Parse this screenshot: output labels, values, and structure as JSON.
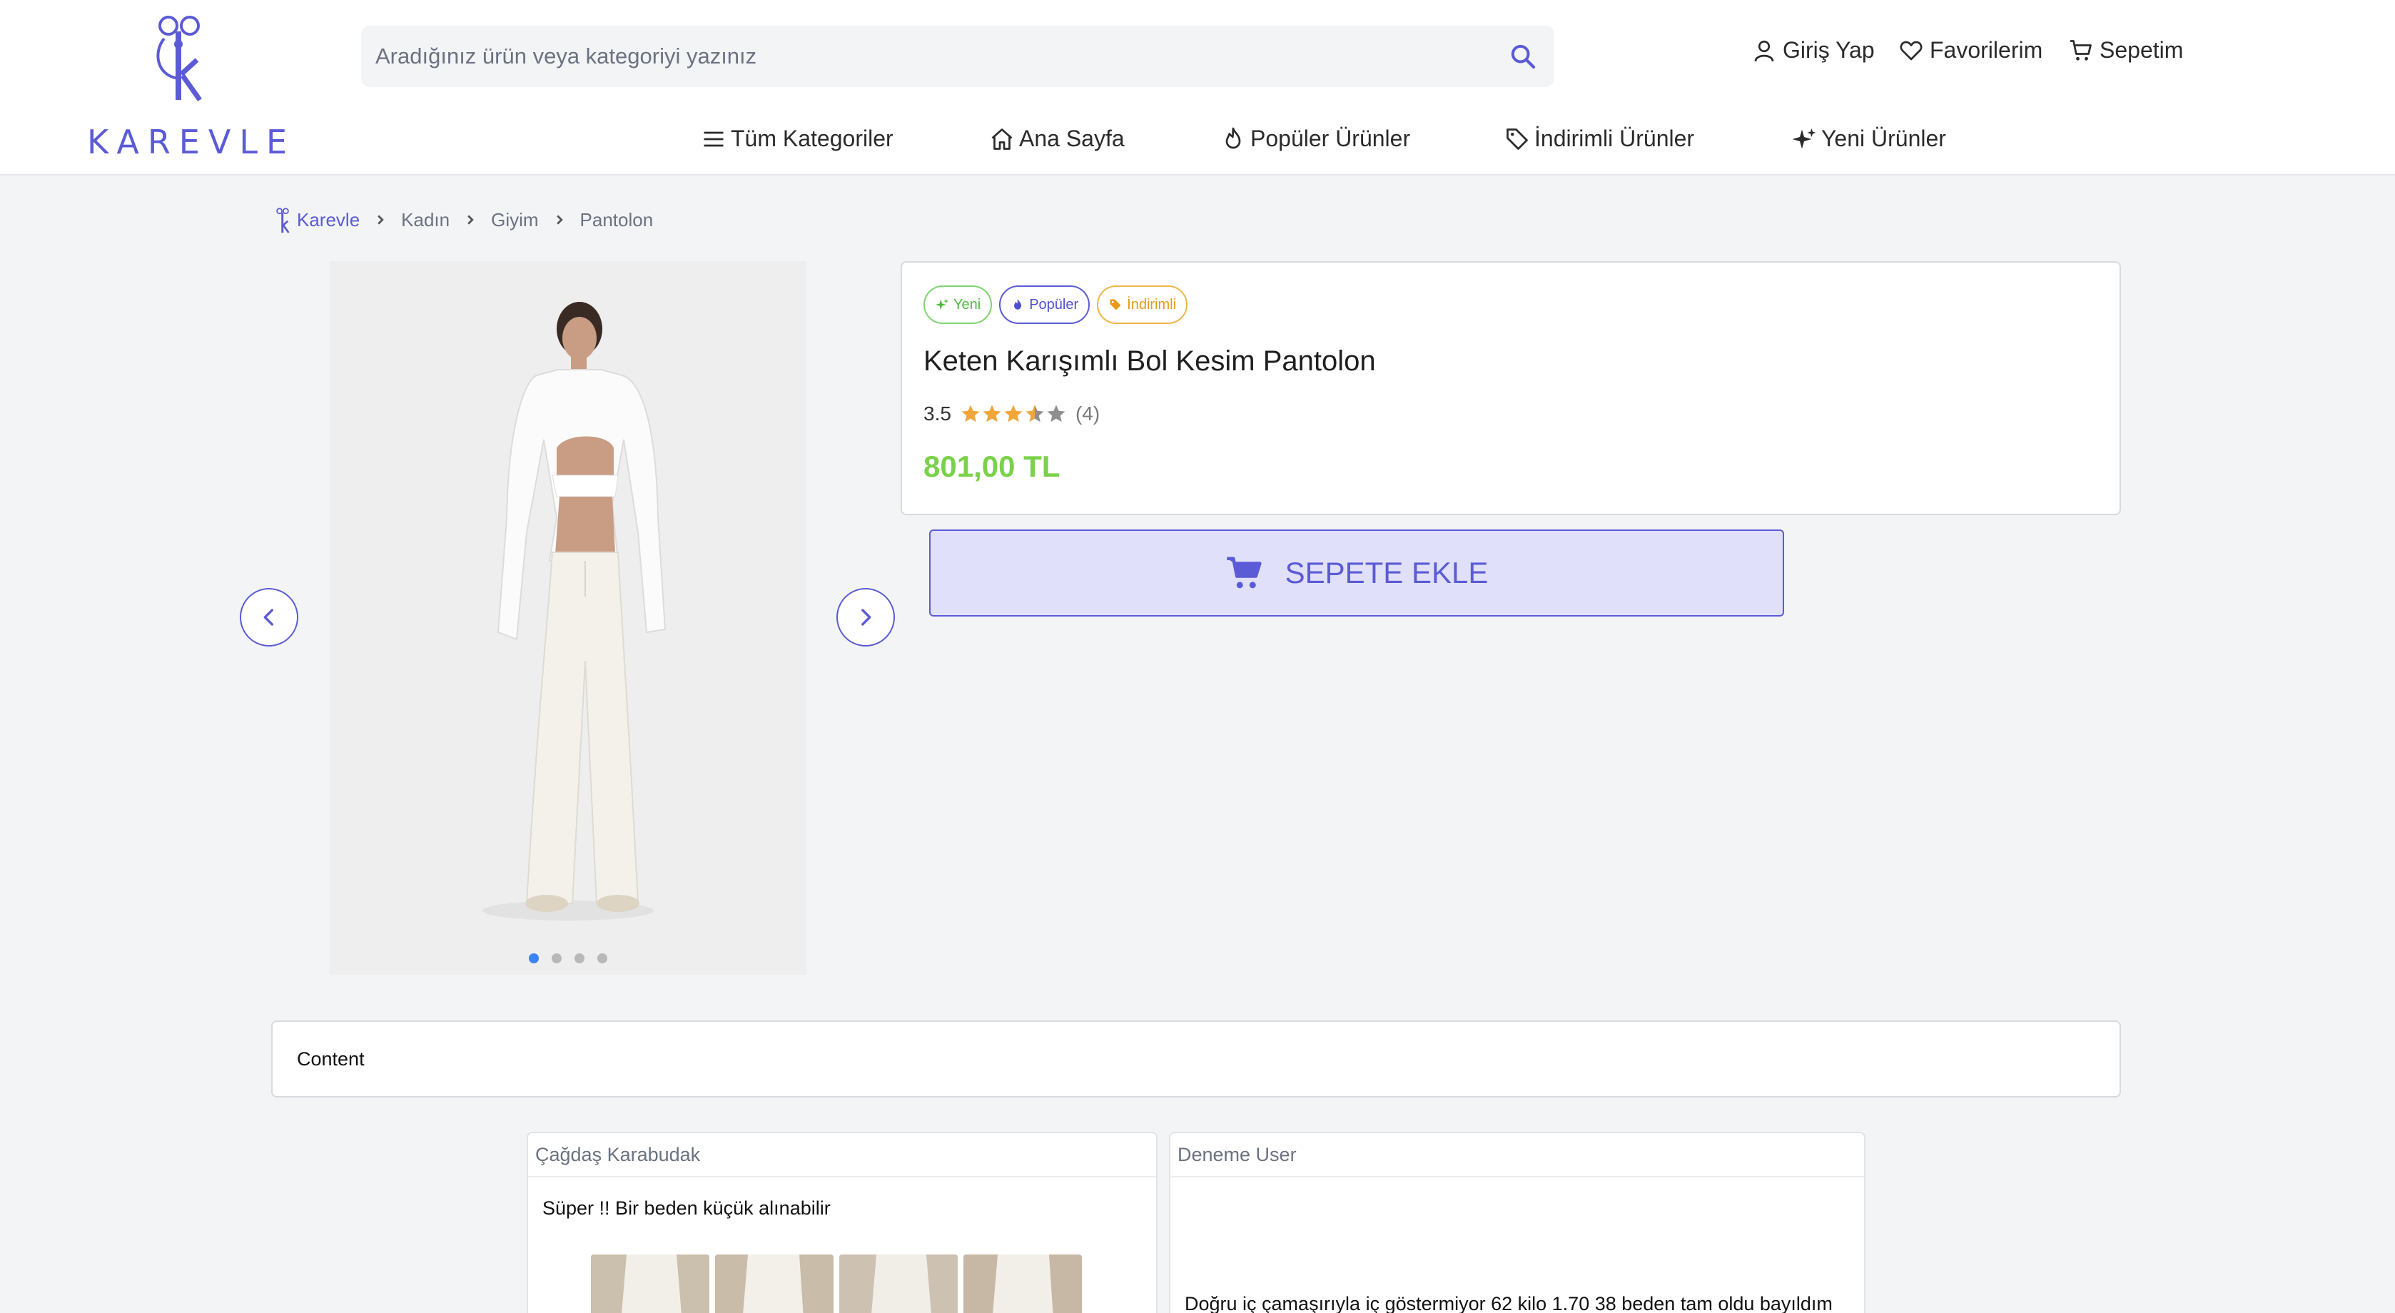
{
  "brand": {
    "name": "KAREVLE",
    "color": "#5b5bd6"
  },
  "search": {
    "placeholder": "Aradığınız ürün veya kategoriyi yazınız",
    "icon": "search-icon"
  },
  "account": {
    "login": "Giriş Yap",
    "favorites": "Favorilerim",
    "cart": "Sepetim"
  },
  "nav": {
    "categories": "Tüm Kategoriler",
    "home": "Ana Sayfa",
    "popular": "Popüler Ürünler",
    "discounted": "İndirimli Ürünler",
    "new": "Yeni Ürünler"
  },
  "breadcrumb": [
    "Karevle",
    "Kadın",
    "Giyim",
    "Pantolon"
  ],
  "gallery": {
    "image_count": 4,
    "active_index": 0
  },
  "product": {
    "badges": {
      "new": "Yeni",
      "popular": "Popüler",
      "discounted": "İndirimli"
    },
    "title": "Keten Karışımlı Bol Kesim Pantolon",
    "rating": "3.5",
    "rating_value": 3.5,
    "review_count": "(4)",
    "price": "801,00 TL",
    "price_color": "#7ad14a"
  },
  "cart_button": {
    "label": "SEPETE EKLE"
  },
  "content_section": {
    "label": "Content"
  },
  "reviews": [
    {
      "author": "Çağdaş Karabudak",
      "text": "Süper !! Bir beden küçük alınabilir",
      "photo_count": 4
    },
    {
      "author": "Deneme User",
      "text": "Doğru iç çamaşırıyla iç göstermiyor 62 kilo 1.70 38 beden tam oldu bayıldım"
    }
  ]
}
